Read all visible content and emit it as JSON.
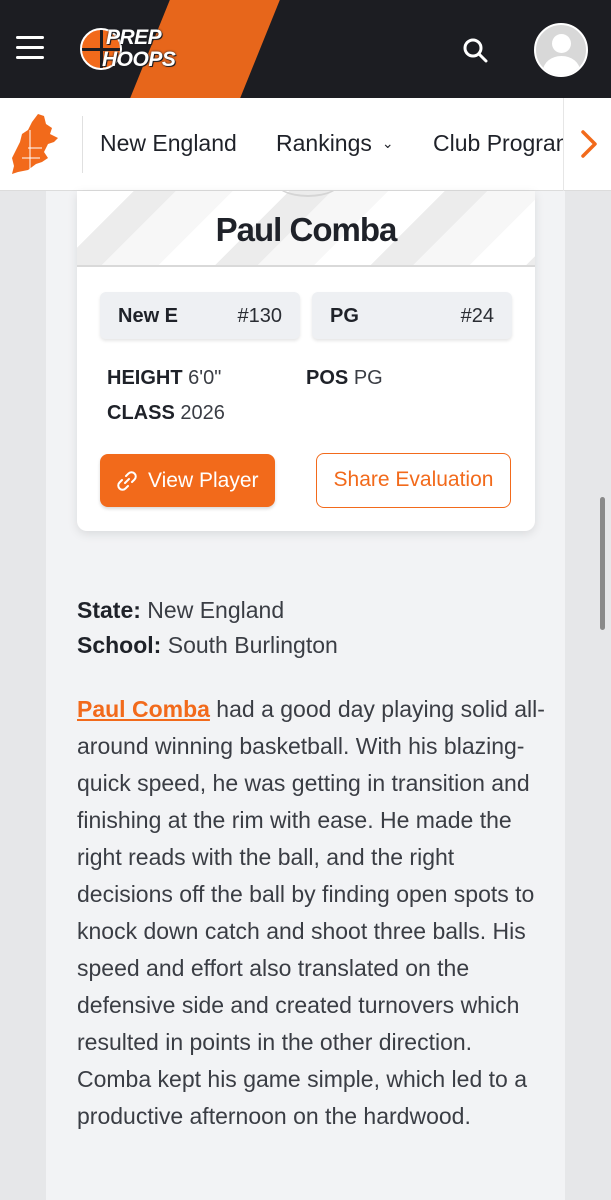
{
  "header": {
    "logo_line1": "PREP",
    "logo_line2": "HOOPS",
    "icons": {
      "menu": "hamburger-menu-icon",
      "search": "search-icon",
      "avatar": "user-avatar-icon"
    },
    "colors": {
      "brand": "#f26a1b",
      "bar": "#1c1d22"
    }
  },
  "subnav": {
    "region_icon": "new-england-map-icon",
    "items": [
      {
        "label": "New England"
      },
      {
        "label": "Rankings",
        "chevron": "⌄"
      },
      {
        "label": "Club Programs"
      }
    ],
    "next_arrow": "›"
  },
  "card": {
    "name": "Paul Comba",
    "rank_region": "New E",
    "rank_region_value": "#130",
    "position_label": "PG",
    "position_rank": "#24",
    "height_label": "HEIGHT",
    "height_value": "6'0\"",
    "pos_label": "POS",
    "pos_value": "PG",
    "class_label": "CLASS",
    "class_value": "2026",
    "view_button": "View Player",
    "share_button": "Share Evaluation"
  },
  "info": {
    "state_label": "State:",
    "state_value": "New England",
    "school_label": "School:",
    "school_value": "South Burlington"
  },
  "evaluation": {
    "player_link": "Paul Comba",
    "text": " had a good day playing solid all-around winning basketball. With his blazing-quick speed, he was getting in transition and finishing at the rim with ease. He made the right reads with the ball, and the right decisions off the ball by finding open spots to knock down catch and shoot three balls. His speed and effort also translated on the defensive side and created turnovers which resulted in points in the other direction. Comba kept his game simple, which led to a productive afternoon on the hardwood."
  }
}
